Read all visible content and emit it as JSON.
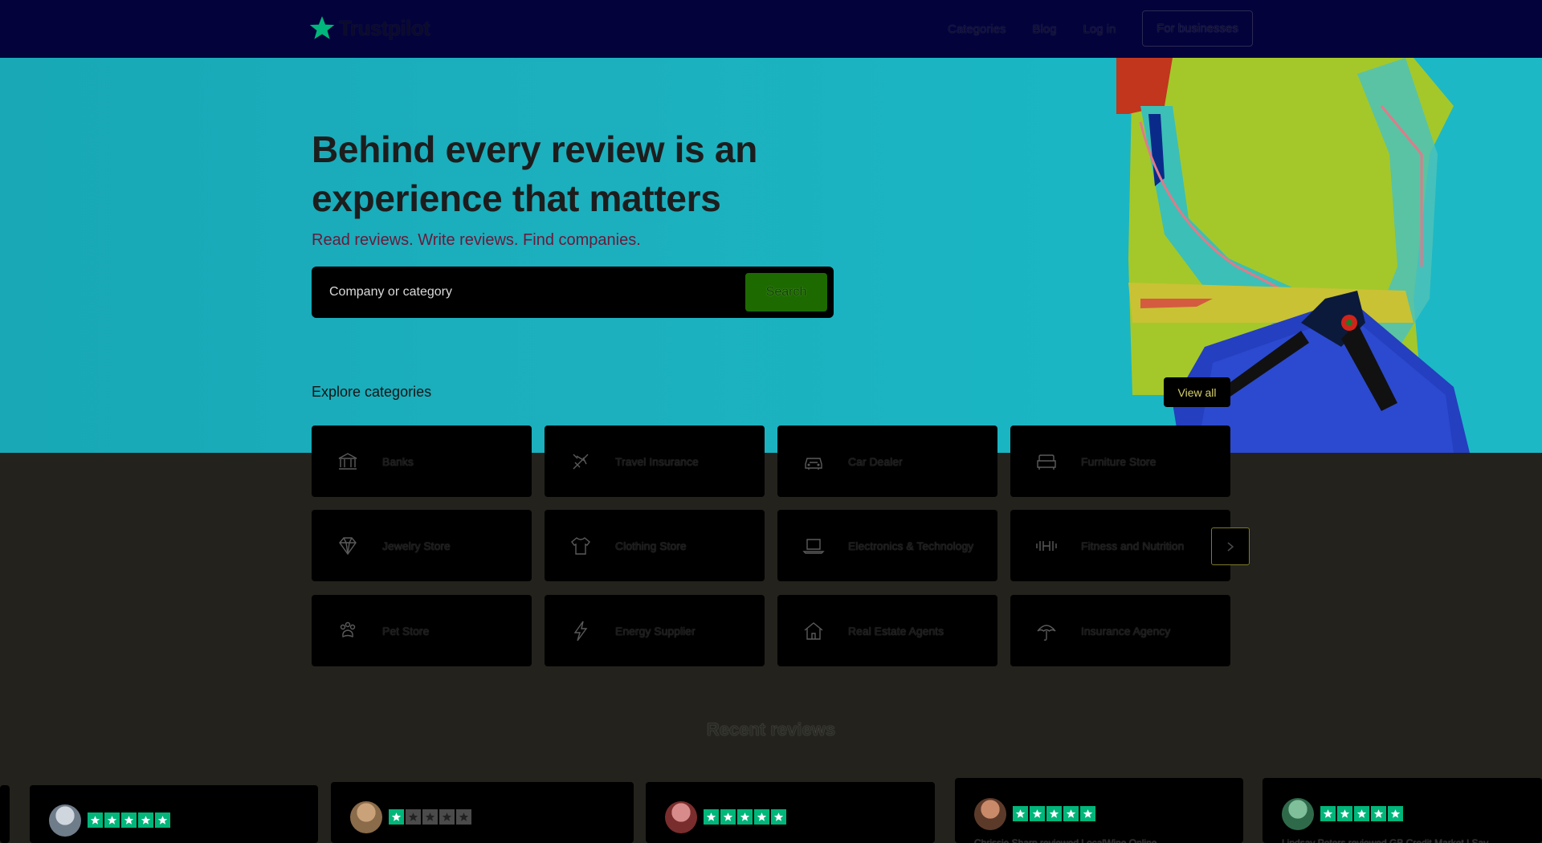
{
  "nav": {
    "logo_text": "Trustpilot",
    "links": [
      "Categories",
      "Blog",
      "Log in"
    ],
    "business_label": "For businesses"
  },
  "hero": {
    "title": "Behind every review is an experience that matters",
    "subtitle": "Read reviews. Write reviews. Find companies.",
    "search_placeholder": "Company or category",
    "search_button": "Search"
  },
  "categories": {
    "title": "Explore categories",
    "view_all": "View all",
    "items": [
      {
        "label": "Banks",
        "icon": "bank-icon"
      },
      {
        "label": "Travel Insurance",
        "icon": "plane-icon"
      },
      {
        "label": "Car Dealer",
        "icon": "car-icon"
      },
      {
        "label": "Furniture Store",
        "icon": "sofa-icon"
      },
      {
        "label": "Jewelry Store",
        "icon": "diamond-icon"
      },
      {
        "label": "Clothing Store",
        "icon": "shirt-icon"
      },
      {
        "label": "Electronics & Technology",
        "icon": "laptop-icon"
      },
      {
        "label": "Fitness and Nutrition",
        "icon": "dumbbell-icon"
      },
      {
        "label": "Pet Store",
        "icon": "paw-icon"
      },
      {
        "label": "Energy Supplier",
        "icon": "lightning-icon"
      },
      {
        "label": "Real Estate Agents",
        "icon": "house-icon"
      },
      {
        "label": "Insurance Agency",
        "icon": "umbrella-icon"
      }
    ]
  },
  "reviews": {
    "title": "Recent reviews",
    "items": [
      {
        "stars": 5,
        "author": ""
      },
      {
        "stars": 1,
        "author": ""
      },
      {
        "stars": 5,
        "author": ""
      },
      {
        "stars": 5,
        "author": "Chrissie Sharp reviewed LocalWine Online"
      },
      {
        "stars": 5,
        "author": "Lindsay Peters reviewed GB Credit Market | Sav"
      }
    ]
  },
  "colors": {
    "nav_bg": "#03023b",
    "hero_bg": "#1ab0be",
    "page_bg": "#23221c",
    "trustpilot_green": "#00b67a",
    "search_button": "#1d6b00"
  }
}
